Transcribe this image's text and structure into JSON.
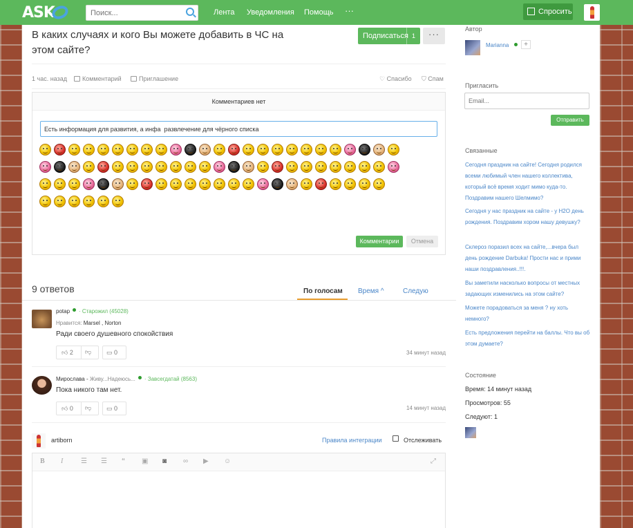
{
  "header": {
    "logo": "ASK",
    "search_placeholder": "Поиск...",
    "nav": [
      "Лента",
      "Уведомления",
      "Помощь"
    ],
    "more": "···",
    "ask_label": "Спросить",
    "accent": "#5cb85c"
  },
  "question": {
    "title": "В каких случаях и кого Вы можете добавить в ЧС на этом сайте?",
    "subscribe_label": "Подписаться",
    "subscribe_count": "1",
    "more": "···",
    "time": "1 час. назад",
    "comment": "Комментарий",
    "invite": "Приглашение",
    "thanks": "Спасибо",
    "spam": "Спам"
  },
  "comments": {
    "header": "Комментариев нет",
    "input_value": "Есть информация для развития, а инфа  развлечение для чёрного списка",
    "submit": "Комментарии",
    "cancel": "Отмена",
    "smiley_icon": "smiley-icon"
  },
  "answers": {
    "count_label": "9 ответов",
    "sort": [
      "По голосам",
      "Время",
      "Следую"
    ],
    "items": [
      {
        "user": "potap",
        "status": "",
        "rank": "Старожил (45028)",
        "likes_prefix": "Нравится:",
        "likes": "Marsel , Norton",
        "text": "Ради своего душевного спокойствия",
        "up": "2",
        "comments": "0",
        "time": "34 минут назад"
      },
      {
        "user": "Мирослава",
        "status": "Живу...Надеюсь...",
        "rank": "Завсегдатай (8563)",
        "text": "Пока никого там нет.",
        "up": "0",
        "comments": "0",
        "time": "14 минут назад"
      }
    ]
  },
  "editor": {
    "user": "artiborn",
    "rules_link": "Правила интеграции",
    "follow_label": "Отслеживать"
  },
  "sidebar": {
    "author_h": "Автор",
    "author_name": "Marianna",
    "invite_h": "Пригласить",
    "email_placeholder": "Email...",
    "send": "Отправить",
    "related_h": "Связанные",
    "related": [
      "Сегодня праздник на сайте! Сегодня родился всеми любимый член нашего коллектива, который всё время ходит мимо куда-то. Поздравим нашего Шелмимо?",
      "Сегодня у нас праздник на сайте - у H2O день рождения. Поздравим хором нашу девушку?",
      "Склероз поразил всех на сайте,...вчера был день рождение Darbuka! Прости нас и прими наши поздравления..!!!.",
      "Вы заметили насколько вопросы от местных задающих изменились на этом сайте?",
      "Можете порадоваться за меня ? ну хоть немного?",
      "Есть предложения перейти на баллы. Что вы об этом думаете?"
    ],
    "state_h": "Состояние",
    "time": "Время: 14 минут назад",
    "views": "Просмотров: 55",
    "following": "Следуют: 1"
  }
}
